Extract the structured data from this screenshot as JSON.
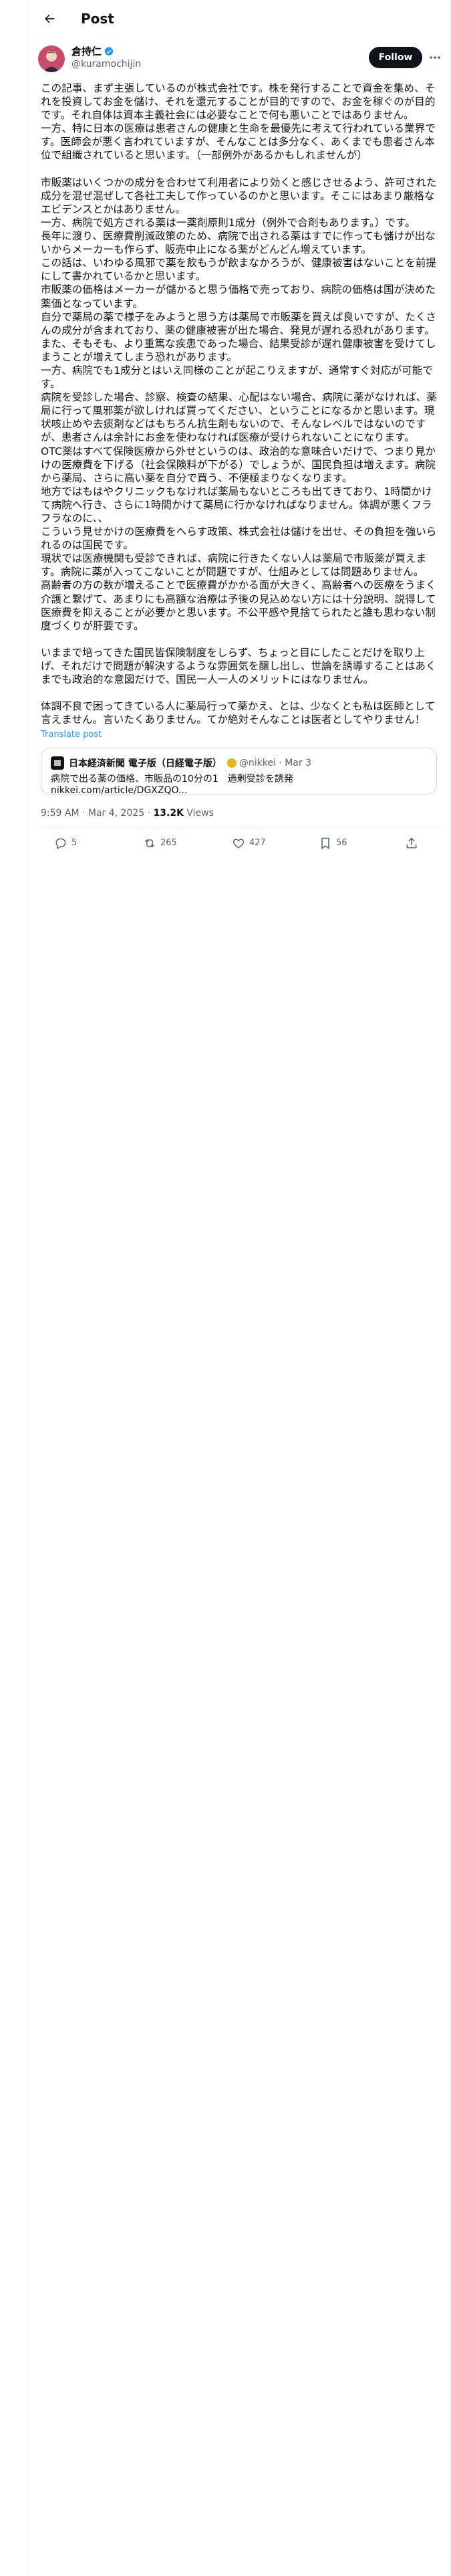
{
  "header": {
    "title": "Post",
    "back_icon": "arrow-left-icon"
  },
  "author": {
    "name": "倉持仁",
    "handle": "@kuramochijin",
    "verified": true,
    "follow_label": "Follow"
  },
  "post": {
    "text": "この記事、まず主張しているのが株式会社です。株を発行することで資金を集め、それを投資してお金を儲け、それを還元することが目的ですので、お金を稼ぐのが目的です。それ自体は資本主義社会には必要なことで何も悪いことではありません。\n一方、特に日本の医療は患者さんの健康と生命を最優先に考えて行われている業界です。医師会が悪く言われていますが、そんなことは多分なく、あくまでも患者さん本位で組織されていると思います。（一部例外があるかもしれませんが）\n\n市販薬はいくつかの成分を合わせて利用者により効くと感じさせるよう、許可された成分を混ぜ混ぜして各社工夫して作っているのかと思います。そこにはあまり厳格なエビデンスとかはありません。\n一方、病院で処方される薬は一薬剤原則1成分（例外で合剤もあります。）です。\n長年に渡り、医療費削減政策のため、病院で出される薬はすでに作っても儲けが出ないからメーカーも作らず、販売中止になる薬がどんどん増えています。\nこの話は、いわゆる風邪で薬を飲もうが飲まなかろうが、健康被害はないことを前提にして書かれているかと思います。\n市販薬の価格はメーカーが儲かると思う価格で売っており、病院の価格は国が決めた薬価となっています。\n自分で薬局の薬で様子をみようと思う方は薬局で市販薬を買えば良いですが、たくさんの成分が含まれており、薬の健康被害が出た場合、発見が遅れる恐れがあります。また、そもそも、より重篤な疾患であった場合、結果受診が遅れ健康被害を受けてしまうことが増えてしまう恐れがあります。\n一方、病院でも1成分とはいえ同様のことが起こりえますが、通常すぐ対応が可能です。\n病院を受診した場合、診察、検査の結果、心配はない場合、病院に薬がなければ、薬局に行って風邪薬が欲しければ買ってください、ということになるかと思います。現状咳止めや去痰剤などはもちろん抗生剤もないので、そんなレベルではないのですが、患者さんは余計にお金を使わなければ医療が受けられないことになります。\nOTC薬はすべて保険医療から外せというのは、政治的な意味合いだけで、つまり見かけの医療費を下げる（社会保険料が下がる）でしょうが、国民負担は増えます。病院から薬局、さらに高い薬を自分で買う、不便極まりなくなります。\n地方ではもはやクリニックもなければ薬局もないところも出てきており、1時間かけて病院へ行き、さらに1時間かけて薬局に行かなければなりません。体調が悪くフラフラなのに、、\nこういう見せかけの医療費をへらす政策、株式会社は儲けを出せ、その負担を強いられるのは国民です。\n現状では医療機関も受診できれば、病院に行きたくない人は薬局で市販薬が買えます。病院に薬が入ってこないことが問題ですが、仕組みとしては問題ありません。\n高齢者の方の数が増えることで医療費がかかる面が大きく、高齢者への医療をうまく介護と繋げて、あまりにも高額な治療は予後の見込めない方には十分説明、説得して医療費を抑えることが必要かと思います。不公平感や見捨てられたと誰も思わない制度づくりが肝要です。\n\nいままで培ってきた国民皆保険制度をしらず、ちょっと目にしたことだけを取り上げ、それだけで問題が解決するような雰囲気を醸し出し、世論を誘導することはあくまでも政治的な意図だけで、国民一人一人のメリットにはなりません。\n\n体調不良で困ってきている人に薬局行って薬かえ、とは、少なくとも私は医師として言えません。言いたくありません。てか絶対そんなことは医者としてやりません！",
    "translate_label": "Translate post"
  },
  "card": {
    "source_name": "日本経済新聞 電子版（日経電子版）",
    "source_handle": "@nikkei",
    "date": "Mar 3",
    "text": "病院で出る薬の価格、市販品の10分の1　過剰受診を誘発",
    "link": "nikkei.com/article/DGXZQO..."
  },
  "meta": {
    "time": "9:59 AM · Mar 4, 2025 · ",
    "views_count": "13.2K",
    "views_label": " Views"
  },
  "actions": {
    "replies": "5",
    "reposts": "265",
    "likes": "427",
    "bookmarks": "56"
  },
  "colors": {
    "accent": "#1d9bf0",
    "text": "#0f1419",
    "muted": "#536471",
    "border": "#cfd9de"
  }
}
